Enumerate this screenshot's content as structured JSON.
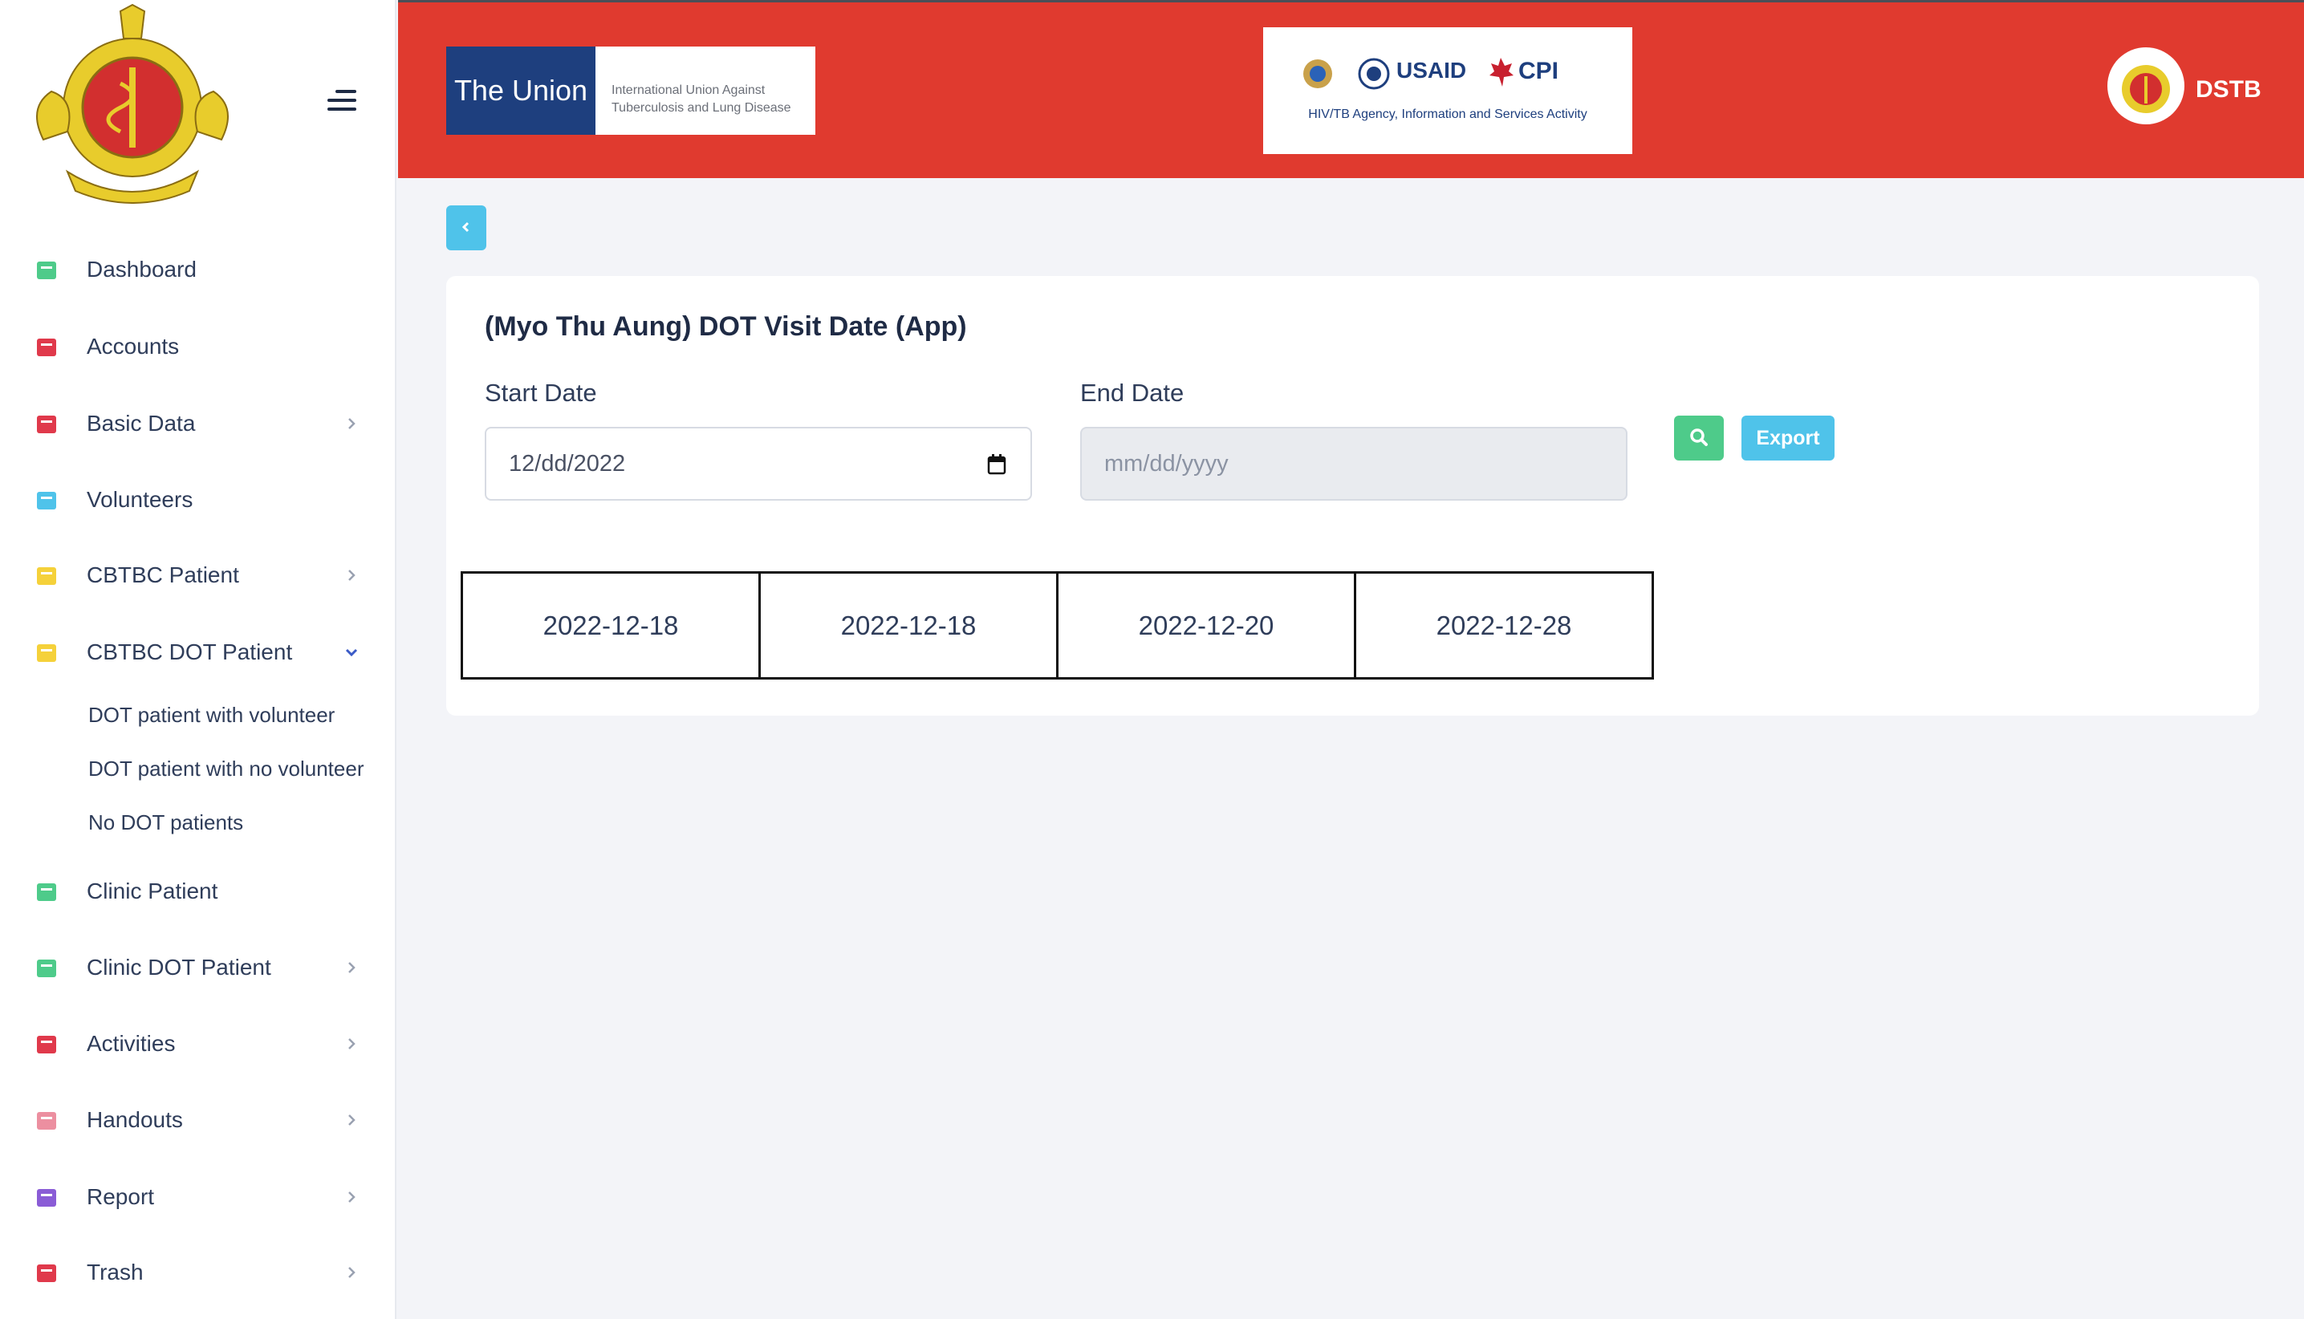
{
  "sidebar": {
    "items": [
      {
        "label": "Dashboard",
        "icon": "box-icon",
        "color": "#4ecb8a"
      },
      {
        "label": "Accounts",
        "icon": "box-icon",
        "color": "#e0394b"
      },
      {
        "label": "Basic Data",
        "icon": "box-icon",
        "color": "#e0394b"
      },
      {
        "label": "Volunteers",
        "icon": "box-icon",
        "color": "#4fc3ea"
      },
      {
        "label": "CBTBC Patient",
        "icon": "box-icon",
        "color": "#f5d13a"
      },
      {
        "label": "CBTBC DOT Patient",
        "icon": "box-icon",
        "color": "#f5d13a"
      },
      {
        "label": "Clinic Patient",
        "icon": "box-icon",
        "color": "#4ecb8a"
      },
      {
        "label": "Clinic DOT Patient",
        "icon": "box-icon",
        "color": "#4ecb8a"
      },
      {
        "label": "Activities",
        "icon": "box-icon",
        "color": "#e0394b"
      },
      {
        "label": "Handouts",
        "icon": "box-icon",
        "color": "#ec8fa0"
      },
      {
        "label": "Report",
        "icon": "box-icon",
        "color": "#8a5cd6"
      },
      {
        "label": "Trash",
        "icon": "box-icon",
        "color": "#e0394b"
      }
    ],
    "sub_items": [
      {
        "label": "DOT patient with volunteer"
      },
      {
        "label": "DOT patient with no volunteer"
      },
      {
        "label": "No DOT patients"
      }
    ]
  },
  "header": {
    "union_name": "The Union",
    "union_tagline_1": "International Union Against",
    "union_tagline_2": "Tuberculosis and Lung Disease",
    "usaid": "USAID",
    "cpi": "CPI",
    "partner_caption": "HIV/TB Agency, Information and Services Activity",
    "user": "DSTB"
  },
  "main": {
    "title": "(Myo Thu Aung) DOT Visit Date (App)",
    "start_label": "Start Date",
    "start_value": "12/dd/2022",
    "end_label": "End Date",
    "end_placeholder": "mm/dd/yyyy",
    "export_label": "Export",
    "visit_dates": [
      "2022-12-18",
      "2022-12-18",
      "2022-12-20",
      "2022-12-28"
    ]
  },
  "colors": {
    "header_bg": "#e03a2f",
    "accent_blue": "#4fc3ea",
    "accent_green": "#4ecb8a"
  }
}
